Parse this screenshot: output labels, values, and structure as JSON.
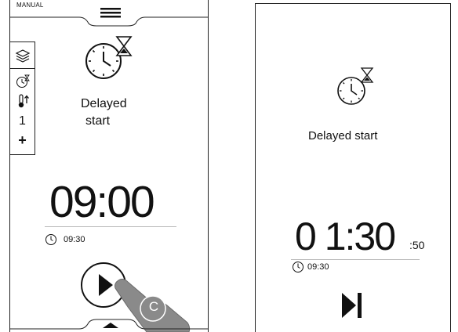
{
  "left_screen": {
    "mode_label": "MANUAL",
    "menu_icon": "hamburger-menu-icon",
    "sidebar": {
      "items": [
        {
          "icon": "layers-icon"
        },
        {
          "icon": "delayed-start-small-icon"
        },
        {
          "icon": "thermometer-up-icon"
        },
        {
          "label": "1"
        },
        {
          "label": "+"
        }
      ]
    },
    "function_icon": "delayed-start-clock-hourglass-icon",
    "function_label_line1": "Delayed",
    "function_label_line2": "start",
    "time_display": "09:00",
    "end_time": "09:30",
    "start_button_icon": "play-icon",
    "bottom_handle_icon": "chevron-up-icon",
    "hand_badge_letter": "C"
  },
  "right_screen": {
    "function_icon": "delayed-start-clock-hourglass-icon",
    "function_label": "Delayed start",
    "countdown_main": "0 1:30",
    "countdown_seconds": ":50",
    "end_time": "09:30",
    "skip_icon": "skip-forward-icon"
  }
}
